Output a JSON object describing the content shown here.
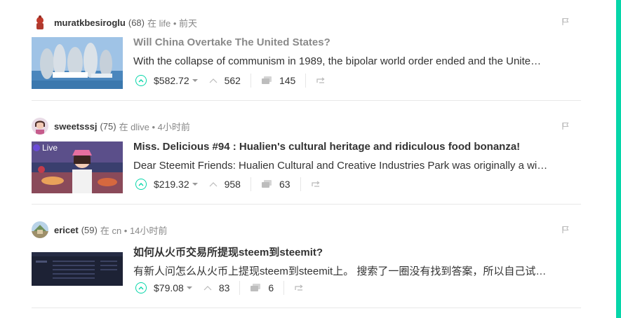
{
  "posts": [
    {
      "author": "muratkbesiroglu",
      "reputation": "(68)",
      "meta": "在 life • 前天",
      "title": "Will China Overtake The United States?",
      "body": "With the collapse of communism in 1989, the bipolar world order ended and the Unite…",
      "payout": "$582.72",
      "votes": "562",
      "comments": "145"
    },
    {
      "author": "sweetsssj",
      "reputation": "(75)",
      "meta": "在 dlive • 4小时前",
      "title": "Miss. Delicious #94 : Hualien's cultural heritage and ridiculous food bonanza!",
      "body": "Dear Steemit Friends: Hualien Cultural and Creative Industries Park was originally a wi…",
      "payout": "$219.32",
      "votes": "958",
      "comments": "63",
      "thumb_badge": "Live"
    },
    {
      "author": "ericet",
      "reputation": "(59)",
      "meta": "在 cn • 14小时前",
      "title": "如何从火币交易所提现steem到steemit?",
      "body": "有新人问怎么从火币上提现steem到steemit上。 搜索了一圈没有找到答案，所以自己试…",
      "payout": "$79.08",
      "votes": "83",
      "comments": "6"
    }
  ],
  "colors": {
    "accent": "#06d6a9",
    "visited_title": "#8a8a8a"
  }
}
